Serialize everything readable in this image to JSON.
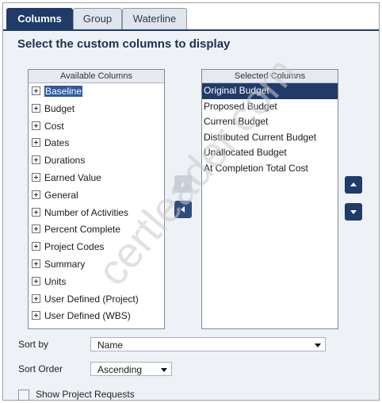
{
  "tabs": [
    "Columns",
    "Group",
    "Waterline"
  ],
  "heading": "Select the custom columns to display",
  "available": {
    "header": "Available Columns",
    "items": [
      "Baseline",
      "Budget",
      "Cost",
      "Dates",
      "Durations",
      "Earned Value",
      "General",
      "Number of Activities",
      "Percent Complete",
      "Project Codes",
      "Summary",
      "Units",
      "User Defined (Project)",
      "User Defined (WBS)"
    ]
  },
  "selected": {
    "header": "Selected Columns",
    "items": [
      "Original Budget",
      "Proposed Budget",
      "Current Budget",
      "Distributed Current Budget",
      "Unallocated Budget",
      "At Completion Total Cost"
    ]
  },
  "sort_by": {
    "label": "Sort by",
    "value": "Name"
  },
  "sort_order": {
    "label": "Sort Order",
    "value": "Ascending"
  },
  "show_requests": {
    "label": "Show Project Requests",
    "checked": false
  },
  "watermark": "certleader.com",
  "icons": {
    "add": "arrow-right-icon",
    "remove": "arrow-left-icon",
    "up": "arrow-up-icon",
    "down": "arrow-down-icon"
  },
  "colors": {
    "accent": "#1f3b69",
    "selection": "#1f3b69",
    "panel": "#eef2f6"
  }
}
